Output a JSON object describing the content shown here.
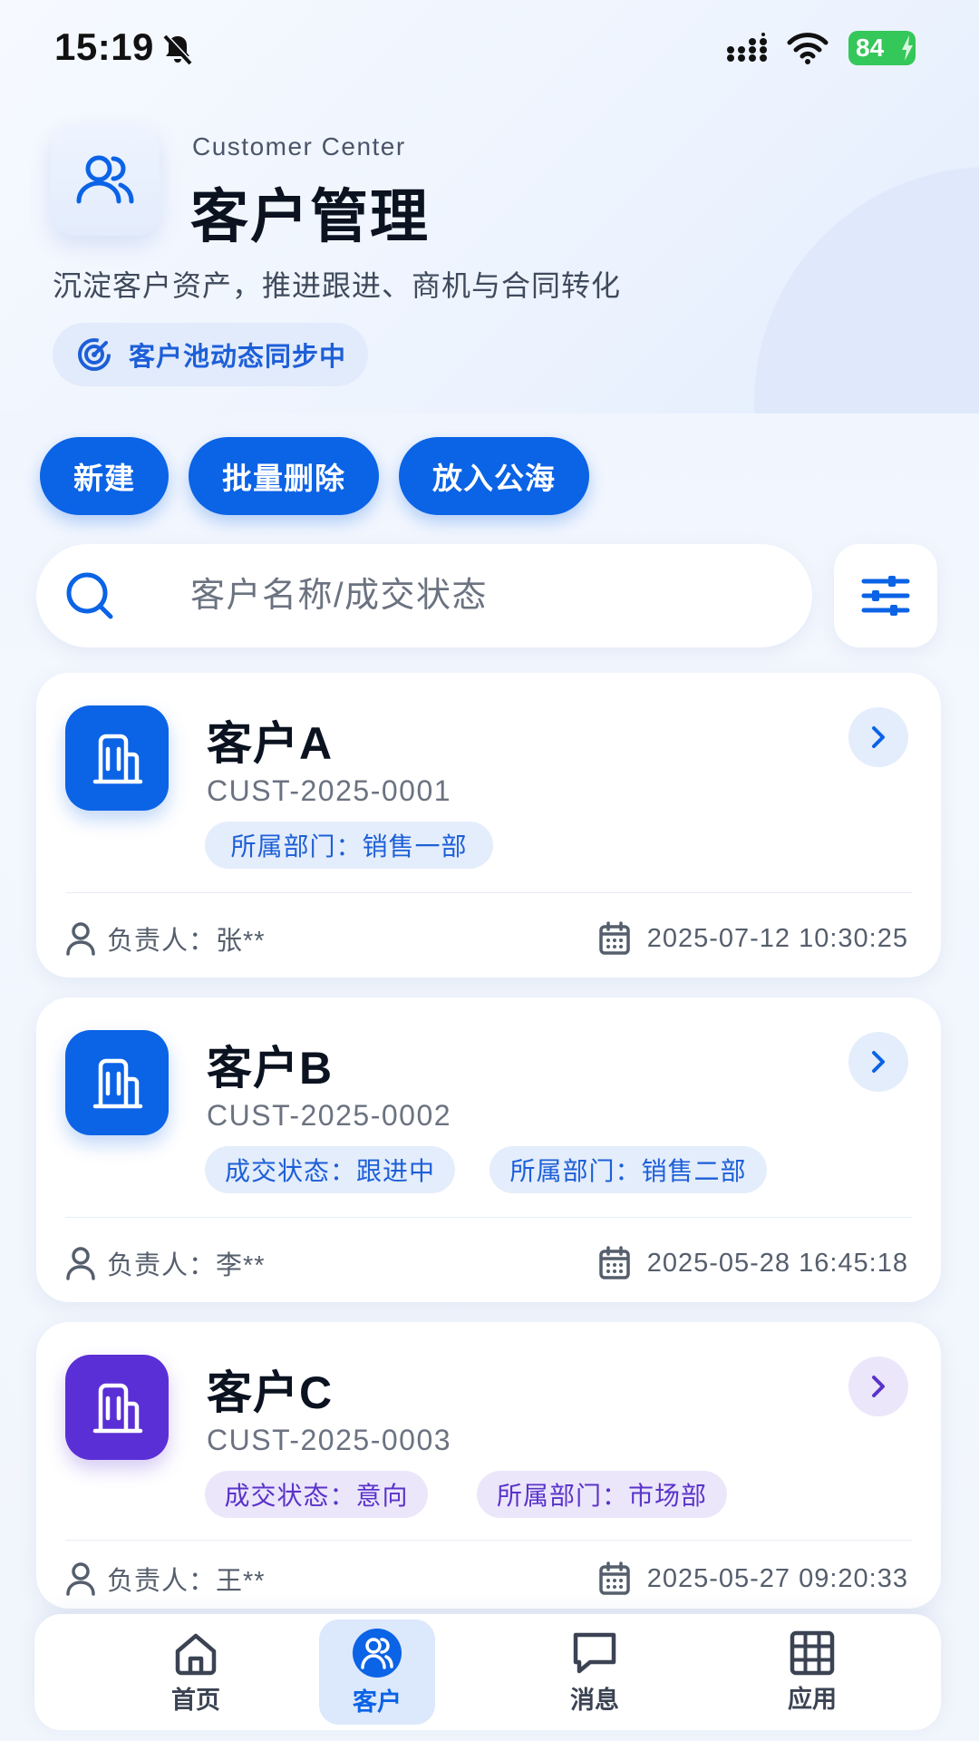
{
  "status_bar": {
    "time": "15:19",
    "battery": "84"
  },
  "header": {
    "subtitle": "Customer Center",
    "title": "客户管理",
    "description": "沉淀客户资产，推进跟进、商机与合同转化",
    "sync_label": "客户池动态同步中"
  },
  "actions": {
    "new_label": "新建",
    "batch_delete_label": "批量删除",
    "public_pool_label": "放入公海"
  },
  "search": {
    "placeholder": "客户名称/成交状态",
    "value": ""
  },
  "customers": [
    {
      "name": "客户A",
      "code": "CUST-2025-0001",
      "tags": [
        "所属部门：销售一部"
      ],
      "owner": "负责人：张**",
      "time": "2025-07-12 10:30:25"
    },
    {
      "name": "客户B",
      "code": "CUST-2025-0002",
      "tags": [
        "成交状态：跟进中",
        "所属部门：销售二部"
      ],
      "owner": "负责人：李**",
      "time": "2025-05-28 16:45:18"
    },
    {
      "name": "客户C",
      "code": "CUST-2025-0003",
      "tags": [
        "成交状态：意向",
        "所属部门：市场部"
      ],
      "owner": "负责人：王**",
      "time": "2025-05-27 09:20:33"
    }
  ],
  "nav": {
    "home": "首页",
    "customers": "客户",
    "messages": "消息",
    "apps": "应用"
  },
  "colors": {
    "primary": "#0b63e6",
    "purple": "#5b2fd6",
    "tag_blue_bg": "#e4edfb",
    "tag_blue_text": "#1d5fd8",
    "tag_purple_bg": "#ece6fb",
    "tag_purple_text": "#5a34c9"
  }
}
